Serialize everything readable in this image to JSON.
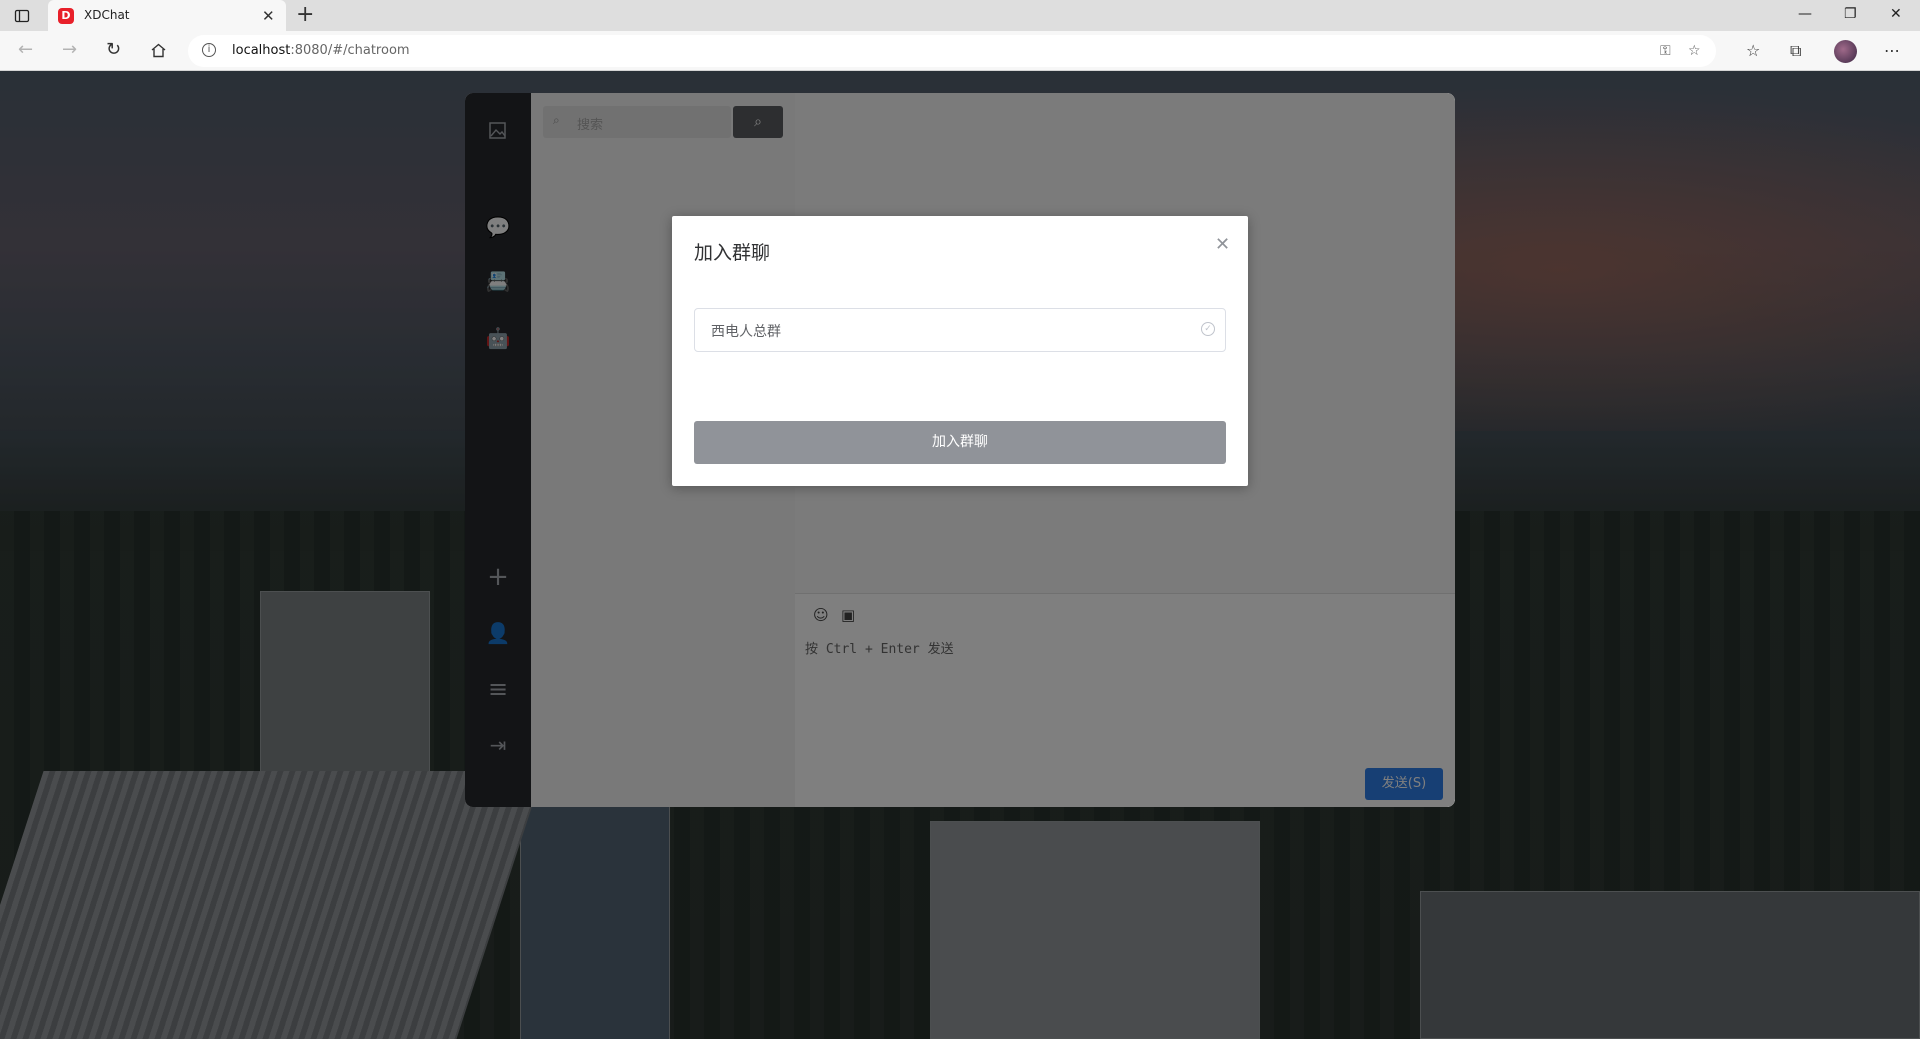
{
  "browser": {
    "tab_title": "XDChat",
    "url_host": "localhost",
    "url_rest": ":8080/#/chatroom",
    "favicon_letter": "D",
    "tab_close": "✕",
    "new_tab": "+"
  },
  "app": {
    "search_placeholder": "搜索",
    "composer_placeholder": "按 Ctrl + Enter 发送",
    "send_label": "发送(S)",
    "sidebar_icons": [
      "image-icon",
      "chat-icon",
      "contacts-icon",
      "android-icon",
      "add-icon",
      "user-icon",
      "menu-icon",
      "logout-icon"
    ]
  },
  "dialog": {
    "title": "加入群聊",
    "selected_group": "西电人总群",
    "submit_label": "加入群聊",
    "close_glyph": "✕"
  },
  "colors": {
    "accent": "#2e7fe8",
    "sidebar_bg": "#26282c",
    "favicon": "#e8202a",
    "disabled_button": "#909399"
  }
}
